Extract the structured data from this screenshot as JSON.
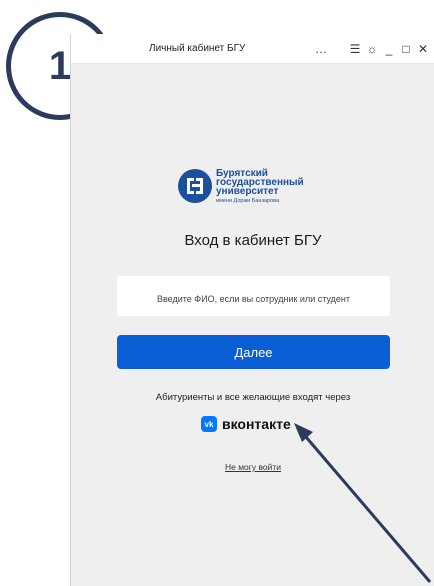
{
  "step": {
    "number": "1"
  },
  "window": {
    "title": "Личный кабинет БГУ",
    "menu_icon": "…",
    "list_icon": "☰",
    "extensions_icon": "☼",
    "minimize_icon": "_",
    "maximize_icon": "□",
    "close_icon": "✕"
  },
  "logo": {
    "line1": "Бурятский",
    "line2": "государственный",
    "line3": "университет",
    "line4": "имени Доржи Банзарова",
    "color": "#1c4f9c"
  },
  "login": {
    "heading": "Вход в кабинет БГУ",
    "input_placeholder": "Введите ФИО, если вы сотрудник или студент",
    "next_button": "Далее",
    "alt_text": "Абитуриенты и все желающие входят через",
    "vk_logo": "vk",
    "vk_label": "вконтакте",
    "cant_login": "Не могу войти",
    "accent_color": "#0a5fd6"
  }
}
